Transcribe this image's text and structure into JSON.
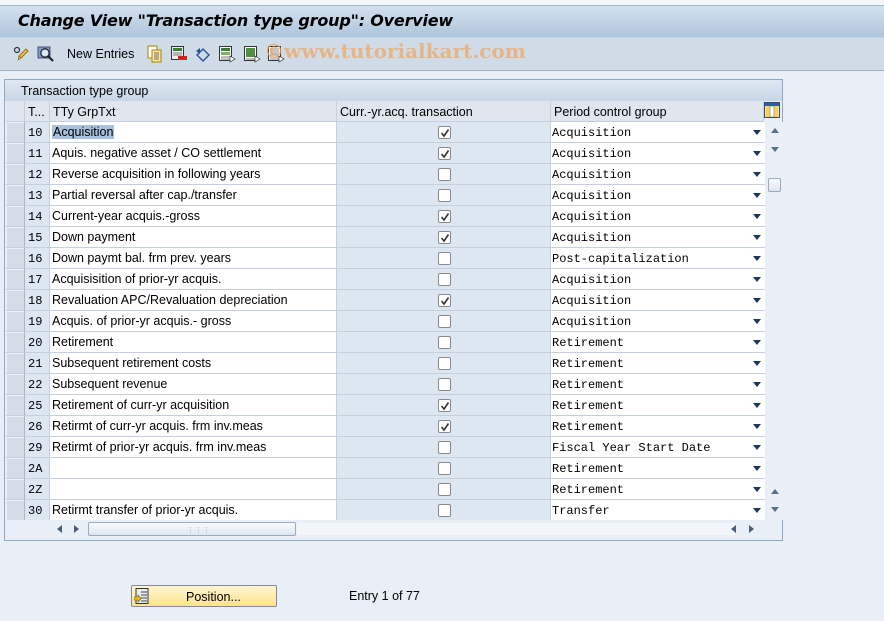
{
  "window": {
    "title": "Change View \"Transaction type group\": Overview"
  },
  "toolbar": {
    "items": [
      {
        "icon": "display-change-icon"
      },
      {
        "icon": "find-icon"
      },
      {
        "label": "New Entries"
      },
      {
        "icon": "copy-as-icon"
      },
      {
        "icon": "delete-icon"
      },
      {
        "icon": "undo-change-icon"
      },
      {
        "icon": "select-all-icon"
      },
      {
        "icon": "select-block-icon"
      },
      {
        "icon": "deselect-all-icon"
      }
    ],
    "new_entries_label": "New Entries"
  },
  "watermark": "©www.tutorialkart.com",
  "panel": {
    "title": "Transaction type group",
    "columns": {
      "key": "T...",
      "text": "TTy GrpTxt",
      "curr_yr": "Curr.-yr.acq. transaction",
      "period": "Period control group"
    },
    "rows": [
      {
        "key": "10",
        "text": "Acquisition",
        "curr_yr": true,
        "period": "Acquisition"
      },
      {
        "key": "11",
        "text": "Aquis. negative asset / CO settlement",
        "curr_yr": true,
        "period": "Acquisition"
      },
      {
        "key": "12",
        "text": "Reverse acquisition in following years",
        "curr_yr": false,
        "period": "Acquisition"
      },
      {
        "key": "13",
        "text": "Partial reversal after cap./transfer",
        "curr_yr": false,
        "period": "Acquisition"
      },
      {
        "key": "14",
        "text": "Current-year acquis.-gross",
        "curr_yr": true,
        "period": "Acquisition"
      },
      {
        "key": "15",
        "text": "Down payment",
        "curr_yr": true,
        "period": "Acquisition"
      },
      {
        "key": "16",
        "text": "Down paymt bal. frm prev. years",
        "curr_yr": false,
        "period": "Post-capitalization"
      },
      {
        "key": "17",
        "text": "Acquisisition of prior-yr acquis.",
        "curr_yr": false,
        "period": "Acquisition"
      },
      {
        "key": "18",
        "text": "Revaluation APC/Revaluation depreciation",
        "curr_yr": true,
        "period": "Acquisition"
      },
      {
        "key": "19",
        "text": "Acquis. of prior-yr acquis.- gross",
        "curr_yr": false,
        "period": "Acquisition"
      },
      {
        "key": "20",
        "text": "Retirement",
        "curr_yr": false,
        "period": "Retirement"
      },
      {
        "key": "21",
        "text": "Subsequent retirement costs",
        "curr_yr": false,
        "period": "Retirement"
      },
      {
        "key": "22",
        "text": "Subsequent revenue",
        "curr_yr": false,
        "period": "Retirement"
      },
      {
        "key": "25",
        "text": "Retirement of curr-yr acquisition",
        "curr_yr": true,
        "period": "Retirement"
      },
      {
        "key": "26",
        "text": "Retirmt of curr-yr acquis. frm inv.meas",
        "curr_yr": true,
        "period": "Retirement"
      },
      {
        "key": "29",
        "text": "Retirmt of prior-yr acquis. frm inv.meas",
        "curr_yr": false,
        "period": "Fiscal Year Start Date"
      },
      {
        "key": "2A",
        "text": "",
        "curr_yr": false,
        "period": "Retirement"
      },
      {
        "key": "2Z",
        "text": "",
        "curr_yr": false,
        "period": "Retirement"
      },
      {
        "key": "30",
        "text": "Retirmt transfer of prior-yr acquis.",
        "curr_yr": false,
        "period": "Transfer"
      }
    ],
    "selected_row_index": 0
  },
  "footer": {
    "position_button_label": "Position...",
    "entry_info": "Entry 1 of 77"
  },
  "colors": {
    "title_gradient_top": "#d3e1ee",
    "title_gradient_bottom": "#aec6dc",
    "toolbar_bg": "#cfdce7",
    "page_bg": "#e8eff6",
    "key_column_bg": "#dce7f2",
    "selection": "#a9c1dc",
    "position_button": "#fbe38f"
  }
}
